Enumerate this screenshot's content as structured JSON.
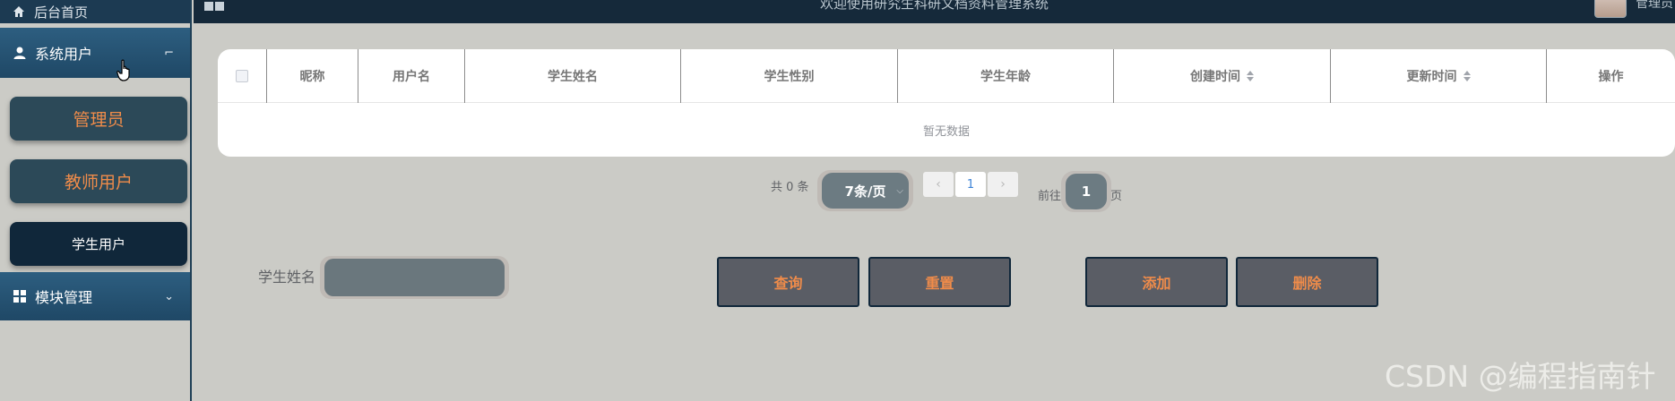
{
  "sidebar": {
    "home_label": "后台首页",
    "system_users_label": "系统用户",
    "system_users_arrow": "⌐",
    "items": [
      {
        "label": "管理员"
      },
      {
        "label": "教师用户"
      },
      {
        "label": "学生用户"
      }
    ],
    "modules_label": "模块管理",
    "modules_arrow": "⌄"
  },
  "topbar": {
    "title": "欢迎使用研究生科研文档资料管理系统",
    "user_label": "管理员"
  },
  "table": {
    "columns": [
      "昵称",
      "用户名",
      "学生姓名",
      "学生性别",
      "学生年龄",
      "创建时间",
      "更新时间",
      "操作"
    ],
    "empty_text": "暂无数据"
  },
  "pagination": {
    "total_text": "共 0 条",
    "page_size": "7条/页",
    "current_page": "1",
    "goto_label": "前往",
    "goto_value": "1",
    "page_unit": "页",
    "prev_icon": "‹",
    "next_icon": "›"
  },
  "search": {
    "label": "学生姓名",
    "value": "",
    "query_label": "查询",
    "reset_label": "重置",
    "add_label": "添加",
    "delete_label": "删除"
  },
  "watermark": "CSDN @编程指南针"
}
